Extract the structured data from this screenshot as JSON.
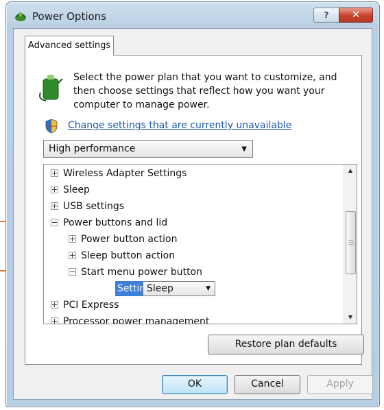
{
  "window": {
    "title": "Power Options",
    "help_label": "?",
    "close_label": "✕"
  },
  "tab": {
    "label": "Advanced settings"
  },
  "description": "Select the power plan that you want to customize, and then choose settings that reflect how you want your computer to manage power.",
  "change_link": "Change settings that are currently unavailable",
  "plan_select": {
    "value": "High performance"
  },
  "tree": {
    "items": [
      {
        "label": "Wireless Adapter Settings",
        "state": "collapsed",
        "level": 0
      },
      {
        "label": "Sleep",
        "state": "collapsed",
        "level": 0
      },
      {
        "label": "USB settings",
        "state": "collapsed",
        "level": 0
      },
      {
        "label": "Power buttons and lid",
        "state": "expanded",
        "level": 0
      },
      {
        "label": "Power button action",
        "state": "collapsed",
        "level": 1
      },
      {
        "label": "Sleep button action",
        "state": "collapsed",
        "level": 1
      },
      {
        "label": "Start menu power button",
        "state": "expanded",
        "level": 1
      },
      {
        "label": "PCI Express",
        "state": "collapsed",
        "level": 0
      },
      {
        "label": "Processor power management",
        "state": "collapsed",
        "level": 0
      }
    ],
    "setting_label": "Setting:",
    "setting_value": "Sleep"
  },
  "buttons": {
    "restore": "Restore plan defaults",
    "ok": "OK",
    "cancel": "Cancel",
    "apply": "Apply"
  },
  "colors": {
    "accent": "#3c7fd9",
    "link": "#1a56b0",
    "callout": "#e07a3c"
  }
}
